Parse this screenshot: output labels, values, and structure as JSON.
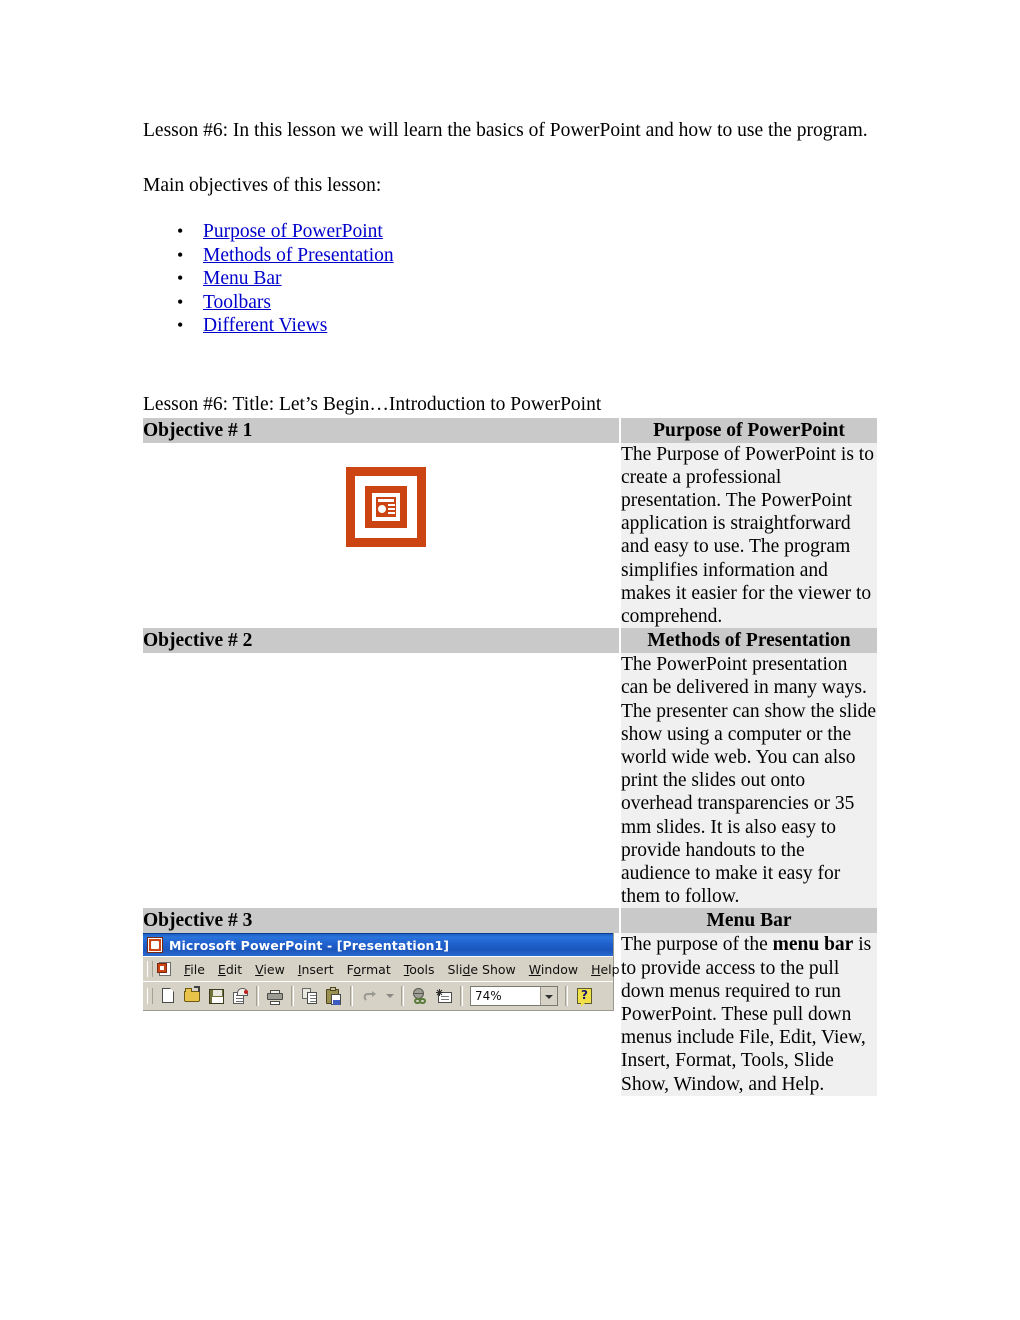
{
  "document": {
    "intro_paragraph": "Lesson #6:  In this lesson we will learn the basics of PowerPoint and how to use the program.",
    "objectives_heading": "Main objectives of this lesson:",
    "bullet_glyph": "•",
    "links": [
      "Purpose of PowerPoint",
      "Methods of Presentation",
      "Menu Bar",
      "Toolbars",
      "Different Views "
    ],
    "link_color": "#0000cc",
    "lesson_title": "Lesson #6: Title: Let’s Begin…Introduction to PowerPoint"
  },
  "table": {
    "header_bg": "#c9c9c9",
    "body_bg": "#f0f0f0",
    "rows": [
      {
        "objective_label": "Objective # 1",
        "topic": "Purpose of PowerPoint",
        "left_visual": "powerpoint-logo",
        "text": "The Purpose of PowerPoint is to create a professional presentation. The PowerPoint application is straightforward and easy to use. The program simplifies information and makes it easier for the viewer to comprehend."
      },
      {
        "objective_label": "Objective # 2",
        "topic": "Methods of Presentation",
        "left_visual": "none",
        "text": "The PowerPoint presentation can be delivered in many ways. The presenter can show the slide show using a computer or the world wide web. You can also print the slides out onto overhead transparencies or 35 mm slides. It is also easy to provide handouts to the audience to make it easy for them to follow."
      },
      {
        "objective_label": "Objective # 3",
        "topic": "Menu Bar",
        "left_visual": "powerpoint-screenshot",
        "text_part1": "The purpose of the ",
        "text_bold": "menu bar",
        "text_part2": " is to provide access to the pull down menus required to run PowerPoint. These pull down menus include File, Edit, View, Insert, Format, Tools, Slide Show, Window, and Help."
      }
    ]
  },
  "powerpoint_screenshot": {
    "title_bar": {
      "title": "Microsoft PowerPoint - [Presentation1]",
      "icon": "powerpoint-app-icon",
      "bg_color": "#2060cc",
      "text_color": "#ffffff"
    },
    "menu_bar": {
      "document_icon": "document-control-icon",
      "items": [
        {
          "pre": "",
          "accel": "F",
          "post": "ile"
        },
        {
          "pre": "",
          "accel": "E",
          "post": "dit"
        },
        {
          "pre": "",
          "accel": "V",
          "post": "iew"
        },
        {
          "pre": "",
          "accel": "I",
          "post": "nsert"
        },
        {
          "pre": "F",
          "accel": "o",
          "post": "rmat"
        },
        {
          "pre": "",
          "accel": "T",
          "post": "ools"
        },
        {
          "pre": "Sli",
          "accel": "d",
          "post": "e Show"
        },
        {
          "pre": "",
          "accel": "W",
          "post": "indow"
        },
        {
          "pre": "",
          "accel": "H",
          "post": "elp"
        }
      ]
    },
    "toolbar": {
      "buttons": [
        "new-icon",
        "open-icon",
        "save-icon",
        "email-icon",
        "print-icon",
        "copy-icon",
        "paste-icon",
        "undo-icon",
        "undo-dropdown-arrow-icon",
        "hyperlink-icon",
        "new-slide-icon",
        "help-icon"
      ],
      "zoom_value": "74%",
      "zoom_dropdown_icon": "chevron-down-icon"
    },
    "bg_color": "#d6d2c6"
  }
}
